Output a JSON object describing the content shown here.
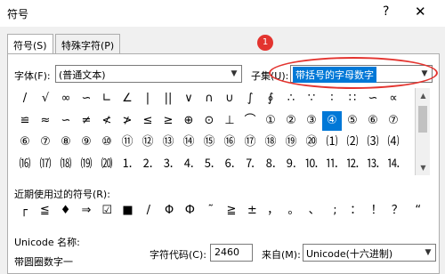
{
  "dialog": {
    "title": "符号",
    "help": "?",
    "close": "✕"
  },
  "tabs": [
    "符号(S)",
    "特殊字符(P)"
  ],
  "font": {
    "label": "字体(F):",
    "value": "(普通文本)"
  },
  "subset": {
    "label": "子集(U):",
    "value": "带括号的字母数字"
  },
  "annotation": {
    "marker": "1",
    "color": "#e3342f"
  },
  "symbol_rows": [
    [
      "/",
      "√",
      "∞",
      "∽",
      "∟",
      "∠",
      "|",
      "||",
      "∨",
      "∩",
      "∪",
      "∫",
      "∮",
      "∴",
      "∵",
      "∶",
      "∷",
      "∽",
      "∝"
    ],
    [
      "≌",
      "≈",
      "∽",
      "≠",
      "≮",
      "≯",
      "≤",
      "≥",
      "⊕",
      "⊙",
      "⊥",
      "⌒",
      "①",
      "②",
      "③",
      "④",
      "⑤",
      "⑥",
      "⑦"
    ],
    [
      "⑥",
      "⑦",
      "⑧",
      "⑨",
      "⑩",
      "⑪",
      "⑫",
      "⑬",
      "⑭",
      "⑮",
      "⑯",
      "⑰",
      "⑱",
      "⑲",
      "⑳",
      "⑴",
      "⑵",
      "⑶",
      "⑷"
    ],
    [
      "⒃",
      "⒄",
      "⒅",
      "⒆",
      "⒇",
      "⒈",
      "⒉",
      "⒊",
      "⒋",
      "⒌",
      "⒍",
      "⒎",
      "⒏",
      "⒐",
      "⒑",
      "⒒",
      "⒓",
      "⒔",
      "⒕"
    ]
  ],
  "selected_symbol": {
    "row": 1,
    "col": 15
  },
  "recent": {
    "label": "近期使用过的符号(R):",
    "symbols": [
      "┌",
      "≦",
      "♦",
      "⇒",
      "☑",
      "■",
      "/",
      "Φ",
      "Ф",
      "˜",
      "≧",
      "±",
      "，",
      "。",
      "、",
      ";",
      "：",
      "！",
      "？",
      "“"
    ]
  },
  "unicode_name": {
    "label": "Unicode 名称:",
    "value": "带圆圈数字一"
  },
  "char_code": {
    "label": "字符代码(C):",
    "value": "2460"
  },
  "from": {
    "label": "来自(M):",
    "value": "Unicode(十六进制)"
  }
}
